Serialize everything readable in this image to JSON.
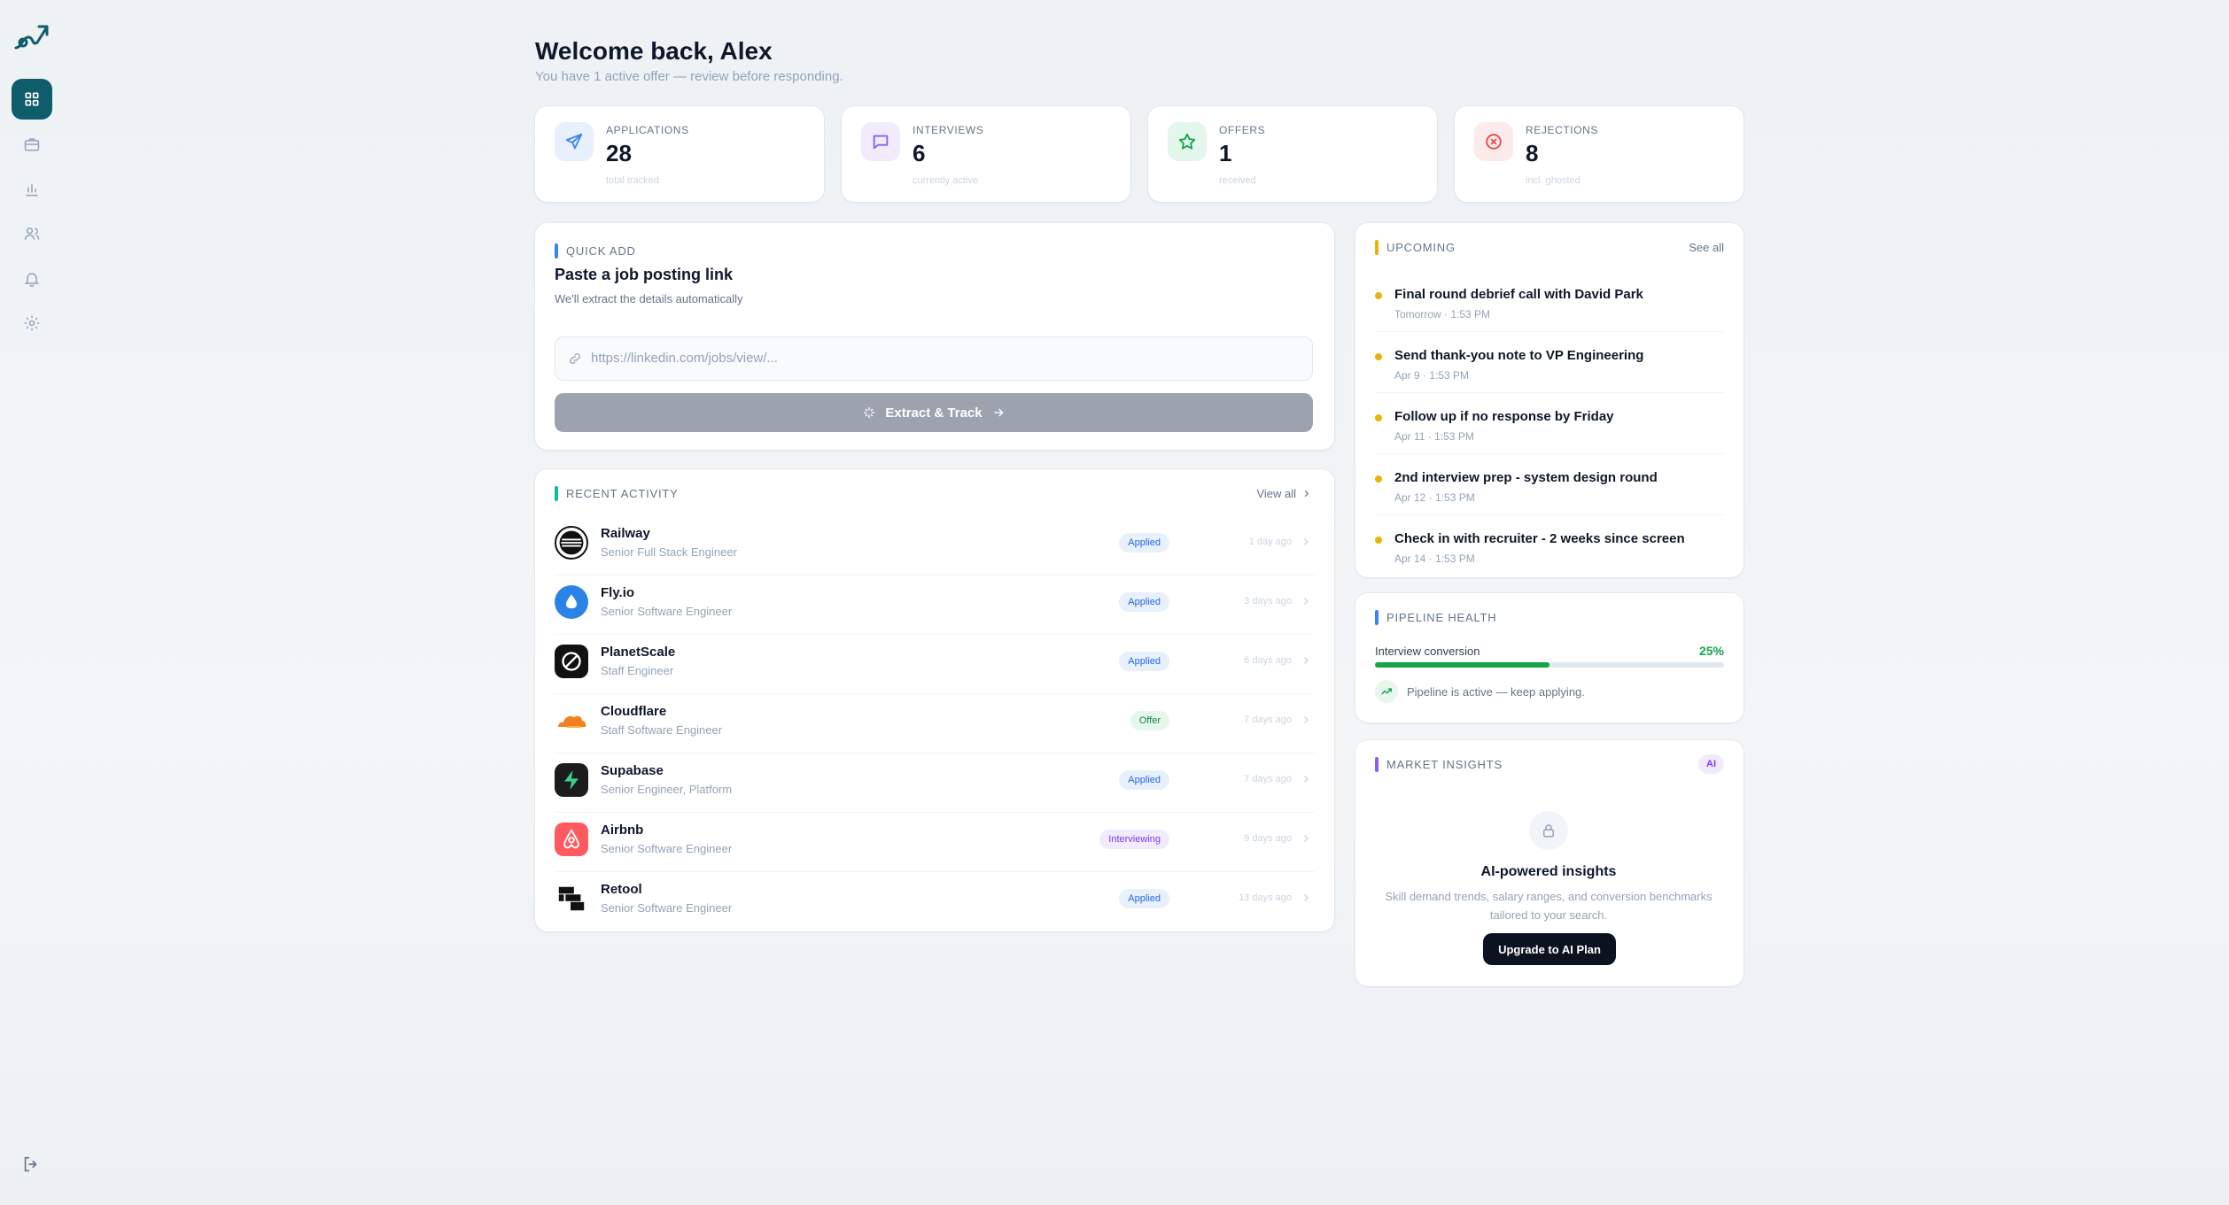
{
  "sidebar": {
    "logo_icon": "trend-arrow-logo",
    "items": [
      {
        "name": "dashboard",
        "icon": "grid-icon",
        "active": true
      },
      {
        "name": "jobs",
        "icon": "briefcase-icon",
        "active": false
      },
      {
        "name": "analytics",
        "icon": "bar-chart-icon",
        "active": false
      },
      {
        "name": "contacts",
        "icon": "users-icon",
        "active": false
      },
      {
        "name": "notifications",
        "icon": "bell-icon",
        "active": false
      },
      {
        "name": "settings",
        "icon": "gear-icon",
        "active": false
      }
    ],
    "logout_icon": "logout-icon"
  },
  "header": {
    "title": "Welcome back, Alex",
    "subtitle": "You have 1 active offer — review before responding."
  },
  "stats": [
    {
      "label": "APPLICATIONS",
      "value": "28",
      "sub": "total tracked",
      "icon": "send-icon",
      "color": "#3b82f6",
      "bg": "#e8f0fd"
    },
    {
      "label": "INTERVIEWS",
      "value": "6",
      "sub": "currently active",
      "icon": "chat-icon",
      "color": "#8b5cf6",
      "bg": "#f1ebfd"
    },
    {
      "label": "OFFERS",
      "value": "1",
      "sub": "received",
      "icon": "star-icon",
      "color": "#16a34a",
      "bg": "#e4f7ec"
    },
    {
      "label": "REJECTIONS",
      "value": "8",
      "sub": "incl. ghosted",
      "icon": "x-circle-icon",
      "color": "#ef4444",
      "bg": "#fdeaea"
    }
  ],
  "quick_add": {
    "section": "QUICK ADD",
    "heading": "Paste a job posting link",
    "subheading": "We'll extract the details automatically",
    "placeholder": "https://linkedin.com/jobs/view/...",
    "button": "Extract & Track"
  },
  "activity": {
    "section": "RECENT ACTIVITY",
    "view_all": "View all",
    "rows": [
      {
        "company": "Railway",
        "role": "Senior Full Stack Engineer",
        "status": "Applied",
        "status_kind": "applied",
        "time": "1 day ago",
        "logo": "railway-logo"
      },
      {
        "company": "Fly.io",
        "role": "Senior Software Engineer",
        "status": "Applied",
        "status_kind": "applied",
        "time": "3 days ago",
        "logo": "flyio-logo"
      },
      {
        "company": "PlanetScale",
        "role": "Staff Engineer",
        "status": "Applied",
        "status_kind": "applied",
        "time": "6 days ago",
        "logo": "planetscale-logo"
      },
      {
        "company": "Cloudflare",
        "role": "Staff Software Engineer",
        "status": "Offer",
        "status_kind": "offer",
        "time": "7 days ago",
        "logo": "cloudflare-logo"
      },
      {
        "company": "Supabase",
        "role": "Senior Engineer, Platform",
        "status": "Applied",
        "status_kind": "applied",
        "time": "7 days ago",
        "logo": "supabase-logo"
      },
      {
        "company": "Airbnb",
        "role": "Senior Software Engineer",
        "status": "Interviewing",
        "status_kind": "interviewing",
        "time": "9 days ago",
        "logo": "airbnb-logo"
      },
      {
        "company": "Retool",
        "role": "Senior Software Engineer",
        "status": "Applied",
        "status_kind": "applied",
        "time": "13 days ago",
        "logo": "retool-logo"
      }
    ]
  },
  "upcoming": {
    "section": "UPCOMING",
    "see_all": "See all",
    "items": [
      {
        "title": "Final round debrief call with David Park",
        "time": "Tomorrow · 1:53 PM"
      },
      {
        "title": "Send thank-you note to VP Engineering",
        "time": "Apr 9 · 1:53 PM"
      },
      {
        "title": "Follow up if no response by Friday",
        "time": "Apr 11 · 1:53 PM"
      },
      {
        "title": "2nd interview prep - system design round",
        "time": "Apr 12 · 1:53 PM"
      },
      {
        "title": "Check in with recruiter - 2 weeks since screen",
        "time": "Apr 14 · 1:53 PM"
      }
    ]
  },
  "pipeline": {
    "section": "PIPELINE HEALTH",
    "label": "Interview conversion",
    "percent_text": "25%",
    "progress_fraction": 0.5,
    "note": "Pipeline is active — keep applying."
  },
  "insights": {
    "section": "MARKET INSIGHTS",
    "badge": "AI",
    "title": "AI-powered insights",
    "description": "Skill demand trends, salary ranges, and conversion benchmarks tailored to your search.",
    "button": "Upgrade to AI Plan"
  },
  "colors": {
    "accent": "#0f5c6b",
    "upcoming_dot": "#eab308",
    "success": "#16a34a"
  }
}
